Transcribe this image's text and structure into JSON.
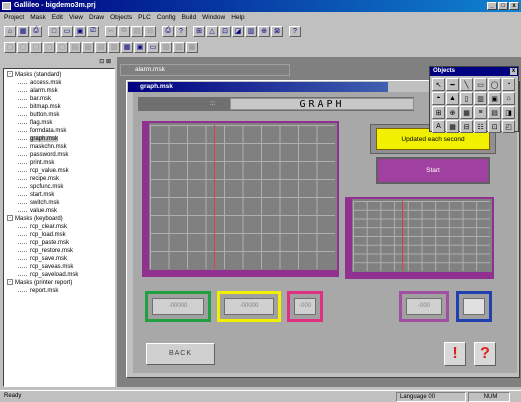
{
  "window": {
    "title": "Gallileo - bigdemo3m.prj",
    "controls": [
      "_",
      "□",
      "x"
    ]
  },
  "menu": [
    "Project",
    "Mask",
    "Edit",
    "View",
    "Draw",
    "Objects",
    "PLC",
    "Config",
    "Build",
    "Window",
    "Help"
  ],
  "toolbar1": [
    "⌂",
    "▦",
    "⎙",
    "□",
    "▭",
    "▣",
    "⎚",
    "✂",
    "⧉",
    "▤",
    "⊟",
    "⎙",
    "?",
    "⊞",
    "△",
    "⊡",
    "◪",
    "▥",
    "⊕",
    "⊠",
    "?"
  ],
  "toolbar2": [
    "▢",
    "▢",
    "▢",
    "▢",
    "▢",
    "▤",
    "▥",
    "▤",
    "▥",
    "▦",
    "▣",
    "▭",
    "▨",
    "▧",
    "▦"
  ],
  "left_panel": {
    "header": "⊡ ⊠"
  },
  "tree": [
    {
      "label": "Masks (standard)",
      "level": 0,
      "expanded": true
    },
    {
      "label": "access.msk",
      "level": 1
    },
    {
      "label": "alarm.msk",
      "level": 1
    },
    {
      "label": "bar.msk",
      "level": 1
    },
    {
      "label": "bitmap.msk",
      "level": 1
    },
    {
      "label": "button.msk",
      "level": 1
    },
    {
      "label": "flag.msk",
      "level": 1
    },
    {
      "label": "formdata.msk",
      "level": 1
    },
    {
      "label": "graph.msk",
      "level": 1,
      "selected": true
    },
    {
      "label": "maskchn.msk",
      "level": 1
    },
    {
      "label": "password.msk",
      "level": 1
    },
    {
      "label": "print.msk",
      "level": 1
    },
    {
      "label": "rcp_value.msk",
      "level": 1
    },
    {
      "label": "recipe.msk",
      "level": 1
    },
    {
      "label": "spcfunc.msk",
      "level": 1
    },
    {
      "label": "start.msk",
      "level": 1
    },
    {
      "label": "switch.msk",
      "level": 1
    },
    {
      "label": "value.msk",
      "level": 1
    },
    {
      "label": "Masks (keyboard)",
      "level": 0,
      "expanded": true
    },
    {
      "label": "rcp_clear.msk",
      "level": 1
    },
    {
      "label": "rcp_load.msk",
      "level": 1
    },
    {
      "label": "rcp_paste.msk",
      "level": 1
    },
    {
      "label": "rcp_restore.msk",
      "level": 1
    },
    {
      "label": "rcp_save.msk",
      "level": 1
    },
    {
      "label": "rcp_saveas.msk",
      "level": 1
    },
    {
      "label": "rcp_saveload.msk",
      "level": 1
    },
    {
      "label": "Masks (printer report)",
      "level": 0,
      "expanded": true
    },
    {
      "label": "report.msk",
      "level": 1
    }
  ],
  "mdi": {
    "background_tab": "alarm.msk",
    "active_title": "graph.msk",
    "header_dots": ":::",
    "graph_title": "GRAPH",
    "status_label": "Updated each second",
    "start_button": "Start",
    "fields": {
      "green": "-00000",
      "yellow": "-00000",
      "pink": "-000",
      "purple": "-000",
      "blue": ""
    },
    "back_button": "BACK",
    "alarm_button": "!",
    "help_button": "?"
  },
  "objects_palette": {
    "title": "Objects",
    "close": "x",
    "tools": [
      "↖",
      "━",
      "╲",
      "▭",
      "◯",
      "◔",
      "◓",
      "▲",
      "▯",
      "▥",
      "▣",
      "⌂",
      "⊞",
      "⊕",
      "▦",
      "≡",
      "▤",
      "◨",
      "A",
      "▦",
      "⊟",
      "☷",
      "⊡",
      "◰"
    ]
  },
  "statusbar": {
    "ready": "Ready",
    "language": "Language 00",
    "num": "NUM"
  },
  "colors": {
    "title_gradient_start": "#000080",
    "plot_frame": "#903090",
    "status_yellow": "#f0f000",
    "start_purple": "#a040a0",
    "alarm_red": "#e02020"
  }
}
